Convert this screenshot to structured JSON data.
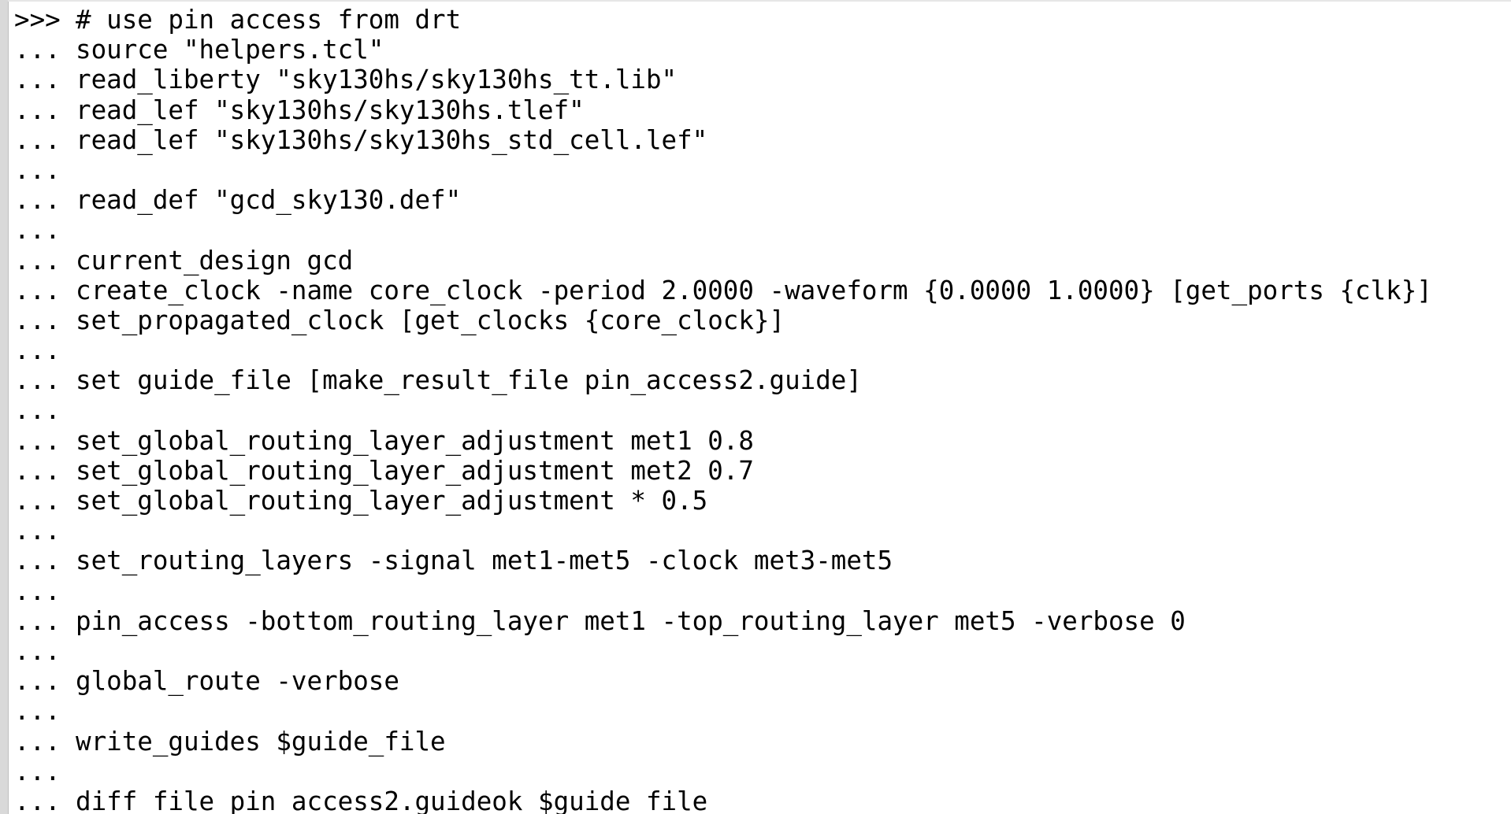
{
  "console": {
    "lines": [
      {
        "prompt": ">>>",
        "code": "# use pin access from drt"
      },
      {
        "prompt": "...",
        "code": "source \"helpers.tcl\""
      },
      {
        "prompt": "...",
        "code": "read_liberty \"sky130hs/sky130hs_tt.lib\""
      },
      {
        "prompt": "...",
        "code": "read_lef \"sky130hs/sky130hs.tlef\""
      },
      {
        "prompt": "...",
        "code": "read_lef \"sky130hs/sky130hs_std_cell.lef\""
      },
      {
        "prompt": "...",
        "code": ""
      },
      {
        "prompt": "...",
        "code": "read_def \"gcd_sky130.def\""
      },
      {
        "prompt": "...",
        "code": ""
      },
      {
        "prompt": "...",
        "code": "current_design gcd"
      },
      {
        "prompt": "...",
        "code": "create_clock -name core_clock -period 2.0000 -waveform {0.0000 1.0000} [get_ports {clk}]"
      },
      {
        "prompt": "...",
        "code": "set_propagated_clock [get_clocks {core_clock}]"
      },
      {
        "prompt": "...",
        "code": ""
      },
      {
        "prompt": "...",
        "code": "set guide_file [make_result_file pin_access2.guide]"
      },
      {
        "prompt": "...",
        "code": ""
      },
      {
        "prompt": "...",
        "code": "set_global_routing_layer_adjustment met1 0.8"
      },
      {
        "prompt": "...",
        "code": "set_global_routing_layer_adjustment met2 0.7"
      },
      {
        "prompt": "...",
        "code": "set_global_routing_layer_adjustment * 0.5"
      },
      {
        "prompt": "...",
        "code": ""
      },
      {
        "prompt": "...",
        "code": "set_routing_layers -signal met1-met5 -clock met3-met5"
      },
      {
        "prompt": "...",
        "code": ""
      },
      {
        "prompt": "...",
        "code": "pin_access -bottom_routing_layer met1 -top_routing_layer met5 -verbose 0"
      },
      {
        "prompt": "...",
        "code": ""
      },
      {
        "prompt": "...",
        "code": "global_route -verbose"
      },
      {
        "prompt": "...",
        "code": ""
      },
      {
        "prompt": "...",
        "code": "write_guides $guide_file"
      },
      {
        "prompt": "...",
        "code": ""
      },
      {
        "prompt": "...",
        "code": "diff_file pin_access2.guideok $guide_file"
      }
    ]
  }
}
